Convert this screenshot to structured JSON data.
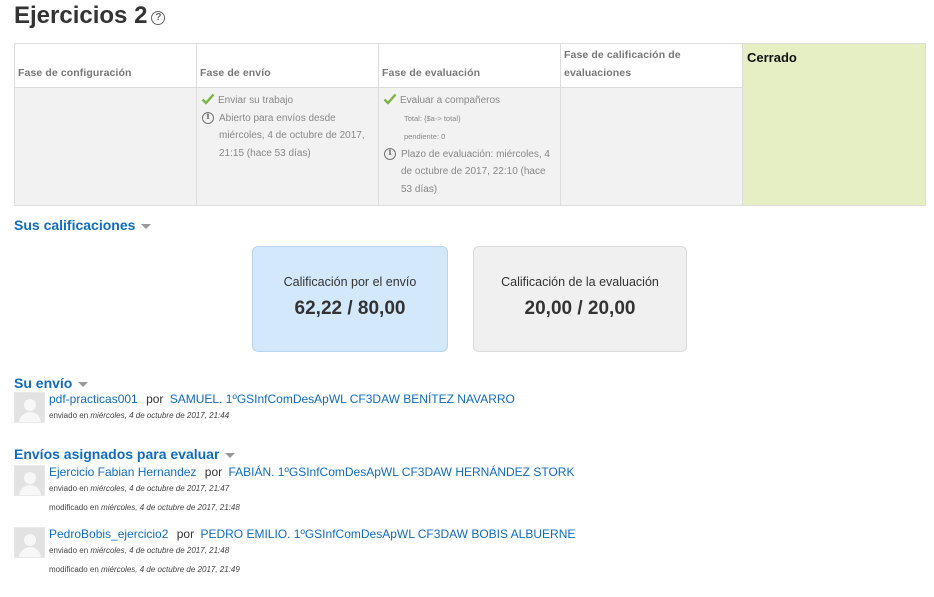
{
  "page": {
    "title": "Ejercicios 2",
    "help_icon": "?"
  },
  "phases": [
    {
      "title": "Fase de configuración"
    },
    {
      "title": "Fase de envío",
      "task_label": "Enviar su trabajo",
      "info_text": "Abierto para envíos desde miércoles, 4 de octubre de 2017, 21:15 (hace 53 días)"
    },
    {
      "title": "Fase de evaluación",
      "task_label": "Evaluar a compañeros",
      "total_label": "Total: {$a-> total}",
      "pending_label": "pendiente: 0",
      "info_text": "Plazo de evaluación: miércoles, 4 de octubre de 2017, 22:10 (hace 53 días)"
    },
    {
      "title": "Fase de calificación de evaluaciones"
    },
    {
      "title": "Cerrado"
    }
  ],
  "grades": {
    "heading": "Sus calificaciones",
    "submission_label": "Calificación por el envío",
    "submission_value": "62,22 / 80,00",
    "assessment_label": "Calificación de la evaluación",
    "assessment_value": "20,00 / 20,00"
  },
  "own_submission": {
    "heading": "Su envío",
    "item": {
      "title": "pdf-practicas001",
      "by": "por",
      "author": "SAMUEL. 1ºGSInfComDesApWL CF3DAW BENÍTEZ NAVARRO",
      "sent_label": "enviado en",
      "sent_date": "miércoles, 4 de octubre de 2017, 21:44"
    }
  },
  "assigned": {
    "heading": "Envíos asignados para evaluar",
    "items": [
      {
        "title": "Ejercicio Fabian Hernandez",
        "by": "por",
        "author": "FABIÁN. 1ºGSInfComDesApWL CF3DAW HERNÁNDEZ STORK",
        "sent_label": "enviado en",
        "sent_date": "miércoles, 4 de octubre de 2017, 21:47",
        "modified_label": "modificado en",
        "modified_date": "miércoles, 4 de octubre de 2017, 21:48"
      },
      {
        "title": "PedroBobis_ejercicio2",
        "by": "por",
        "author": "PEDRO EMILIO. 1ºGSInfComDesApWL CF3DAW BOBIS ALBUERNE",
        "sent_label": "enviado en",
        "sent_date": "miércoles, 4 de octubre de 2017, 21:48",
        "modified_label": "modificado en",
        "modified_date": "miércoles, 4 de octubre de 2017, 21:49"
      }
    ]
  },
  "colors": {
    "link": "#0f6cbf",
    "closed_phase": "#e6efc3",
    "submission_box": "#d4e8fb",
    "assessment_box": "#f0f0f0",
    "check": "#7cb342"
  }
}
